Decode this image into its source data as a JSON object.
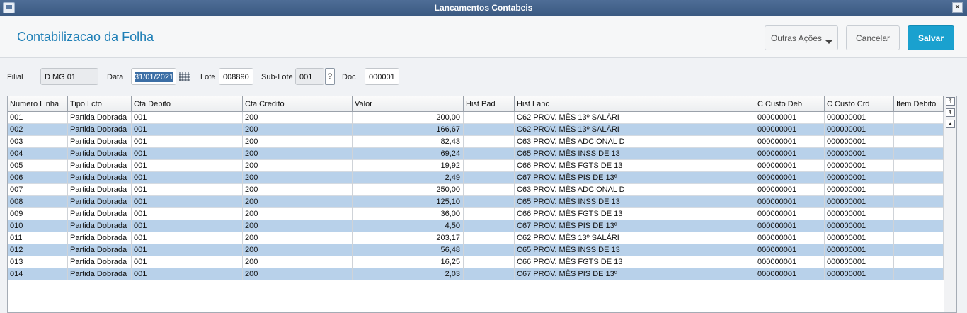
{
  "window": {
    "title": "Lancamentos Contabeis",
    "close_label": "×"
  },
  "header": {
    "page_title": "Contabilizacao da Folha",
    "outras_label": "Outras Ações",
    "cancelar_label": "Cancelar",
    "salvar_label": "Salvar"
  },
  "form": {
    "filial_label": "Filial",
    "filial_value": "D MG 01",
    "data_label": "Data",
    "data_value": "31/01/2021",
    "lote_label": "Lote",
    "lote_value": "008890",
    "sublote_label": "Sub-Lote",
    "sublote_value": "001",
    "help_label": "?",
    "doc_label": "Doc",
    "doc_value": "000001"
  },
  "grid": {
    "columns": [
      "Numero Linha",
      "Tipo Lcto",
      "Cta Debito",
      "Cta Credito",
      "Valor",
      "Hist Pad",
      "Hist Lanc",
      "C Custo Deb",
      "C Custo Crd",
      "Item Debito"
    ],
    "rows": [
      [
        "001",
        "Partida Dobrada",
        "001",
        "200",
        "200,00",
        "",
        "C62 PROV. MÊS 13º SALÁRI",
        "000000001",
        "000000001",
        ""
      ],
      [
        "002",
        "Partida Dobrada",
        "001",
        "200",
        "166,67",
        "",
        "C62 PROV. MÊS 13º SALÁRI",
        "000000001",
        "000000001",
        ""
      ],
      [
        "003",
        "Partida Dobrada",
        "001",
        "200",
        "82,43",
        "",
        "C63 PROV. MÊS ADCIONAL D",
        "000000001",
        "000000001",
        ""
      ],
      [
        "004",
        "Partida Dobrada",
        "001",
        "200",
        "69,24",
        "",
        "C65 PROV. MÊS INSS DE 13",
        "000000001",
        "000000001",
        ""
      ],
      [
        "005",
        "Partida Dobrada",
        "001",
        "200",
        "19,92",
        "",
        "C66 PROV. MÊS FGTS DE 13",
        "000000001",
        "000000001",
        ""
      ],
      [
        "006",
        "Partida Dobrada",
        "001",
        "200",
        "2,49",
        "",
        "C67 PROV. MÊS PIS DE 13º",
        "000000001",
        "000000001",
        ""
      ],
      [
        "007",
        "Partida Dobrada",
        "001",
        "200",
        "250,00",
        "",
        "C63 PROV. MÊS ADCIONAL D",
        "000000001",
        "000000001",
        ""
      ],
      [
        "008",
        "Partida Dobrada",
        "001",
        "200",
        "125,10",
        "",
        "C65 PROV. MÊS INSS DE 13",
        "000000001",
        "000000001",
        ""
      ],
      [
        "009",
        "Partida Dobrada",
        "001",
        "200",
        "36,00",
        "",
        "C66 PROV. MÊS FGTS DE 13",
        "000000001",
        "000000001",
        ""
      ],
      [
        "010",
        "Partida Dobrada",
        "001",
        "200",
        "4,50",
        "",
        "C67 PROV. MÊS PIS DE 13º",
        "000000001",
        "000000001",
        ""
      ],
      [
        "011",
        "Partida Dobrada",
        "001",
        "200",
        "203,17",
        "",
        "C62 PROV. MÊS 13º SALÁRI",
        "000000001",
        "000000001",
        ""
      ],
      [
        "012",
        "Partida Dobrada",
        "001",
        "200",
        "56,48",
        "",
        "C65 PROV. MÊS INSS DE 13",
        "000000001",
        "000000001",
        ""
      ],
      [
        "013",
        "Partida Dobrada",
        "001",
        "200",
        "16,25",
        "",
        "C66 PROV. MÊS FGTS DE 13",
        "000000001",
        "000000001",
        ""
      ],
      [
        "014",
        "Partida Dobrada",
        "001",
        "200",
        "2,03",
        "",
        "C67 PROV. MÊS PIS DE 13º",
        "000000001",
        "000000001",
        ""
      ]
    ]
  },
  "colors": {
    "title_bar": "#3b5a82",
    "accent": "#1e7fb6",
    "save_button": "#1aa1cf",
    "row_alt": "#b8d1ea"
  }
}
